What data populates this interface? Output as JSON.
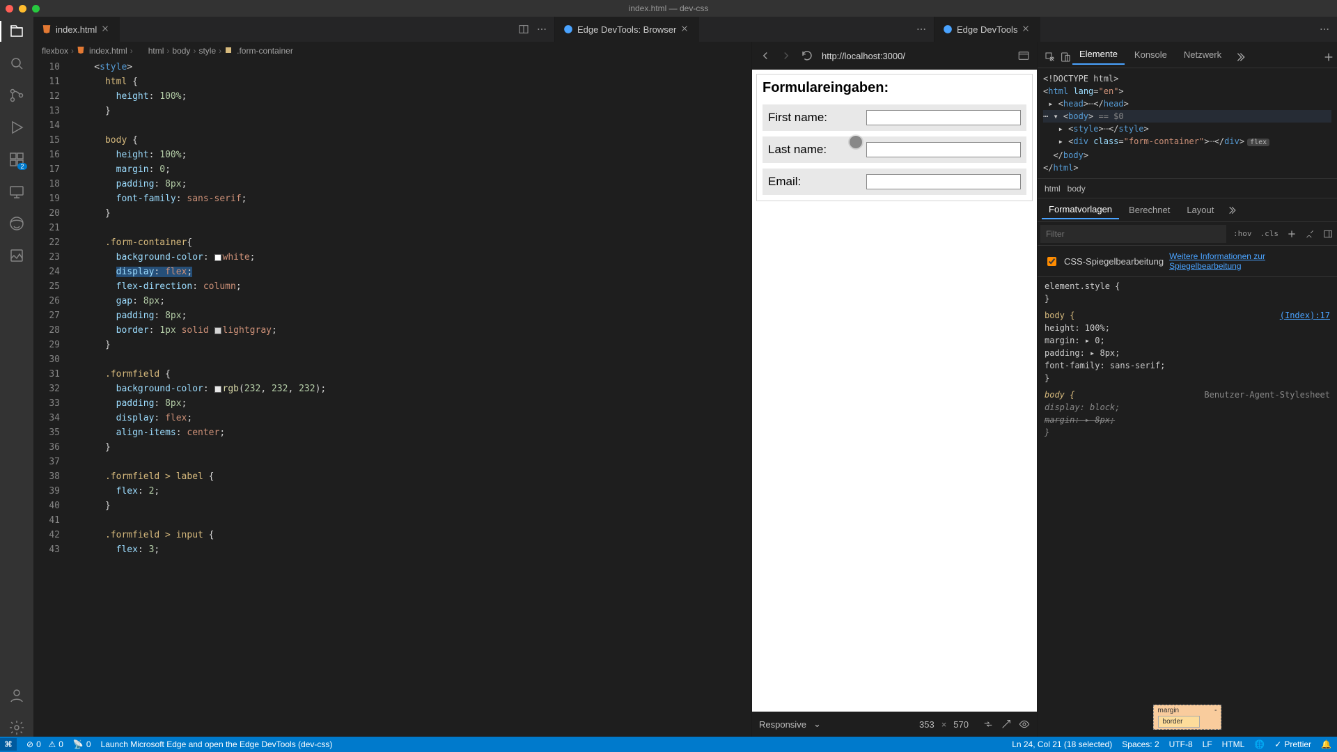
{
  "window_title": "index.html — dev-css",
  "activity_badge": "2",
  "tabs": {
    "editor": {
      "label": "index.html"
    },
    "browser": {
      "label": "Edge DevTools: Browser"
    },
    "devtools": {
      "label": "Edge DevTools"
    }
  },
  "breadcrumb": [
    "flexbox",
    "index.html",
    "html",
    "body",
    "style",
    ".form-container"
  ],
  "gutter": [
    "10",
    "11",
    "12",
    "13",
    "14",
    "15",
    "16",
    "17",
    "18",
    "19",
    "20",
    "21",
    "22",
    "23",
    "24",
    "25",
    "26",
    "27",
    "28",
    "29",
    "30",
    "31",
    "32",
    "33",
    "34",
    "35",
    "36",
    "37",
    "38",
    "39",
    "40",
    "41",
    "42",
    "43"
  ],
  "browser_url": "http://localhost:3000/",
  "device_bar": {
    "mode": "Responsive",
    "w": "353",
    "h": "570"
  },
  "form": {
    "title": "Formulareingaben:",
    "first": "First name:",
    "last": "Last name:",
    "email": "Email:"
  },
  "devtools_tabs": [
    "Elemente",
    "Konsole",
    "Netzwerk"
  ],
  "dom_crumbs": [
    "html",
    "body"
  ],
  "styles_tabs": [
    "Formatvorlagen",
    "Berechnet",
    "Layout"
  ],
  "filter_placeholder": "Filter",
  "filter_tags": {
    "hov": ":hov",
    "cls": ".cls"
  },
  "mirror": {
    "label": "CSS-Spiegelbearbeitung",
    "link": "Weitere Informationen zur Spiegelbearbeitung"
  },
  "styles_rules": {
    "element": "element.style {",
    "body_sel": "body {",
    "body_link": "(Index):17",
    "body_props": [
      "  height: 100%;",
      "  margin: ▸ 0;",
      "  padding: ▸ 8px;",
      "  font-family: sans-serif;"
    ],
    "close": "}",
    "ua_hdr": "Benutzer-Agent-Stylesheet",
    "ua_props": [
      "  display: block;",
      "  margin: ▸ 8px;"
    ]
  },
  "box_model": {
    "margin": "margin",
    "border": "border",
    "dash": "-"
  },
  "status": {
    "remote": "⎇",
    "errors": "0",
    "warnings": "0",
    "port": "0",
    "launch": "Launch Microsoft Edge and open the Edge DevTools (dev-css)",
    "pos": "Ln 24, Col 21 (18 selected)",
    "spaces": "Spaces: 2",
    "enc": "UTF-8",
    "eol": "LF",
    "lang": "HTML",
    "prettier": "Prettier"
  }
}
